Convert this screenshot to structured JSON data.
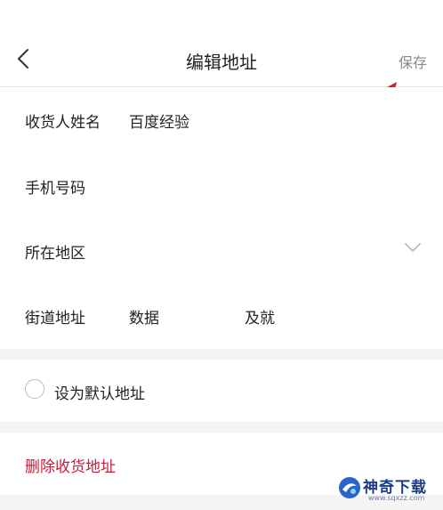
{
  "header": {
    "title": "编辑地址",
    "save_label": "保存"
  },
  "form": {
    "rows": [
      {
        "label": "收货人姓名",
        "value": "百度经验"
      },
      {
        "label": "手机号码",
        "value": ""
      },
      {
        "label": "所在地区",
        "value": ""
      },
      {
        "label": "街道地址",
        "value": "数据",
        "value2": "及就"
      }
    ]
  },
  "default_option": {
    "label": "设为默认地址",
    "checked": false
  },
  "delete": {
    "label": "删除收货地址"
  },
  "watermark": {
    "name": "神奇下载",
    "url": "www.sqxzz.com"
  },
  "colors": {
    "delete_text": "#c2203c",
    "annotation_arrow": "#e01e1e",
    "save_text": "#888888",
    "watermark_text": "#1c3e8a"
  }
}
